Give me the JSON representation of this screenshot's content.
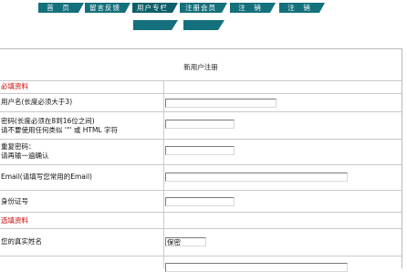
{
  "nav": {
    "tabs": [
      "首　页",
      "留言反馈",
      "用户专栏",
      "注册会员",
      "注　销",
      "注　销"
    ],
    "active_tab": "用户专栏",
    "sub_tabs": [
      "",
      ""
    ]
  },
  "form": {
    "title": "新用户注册",
    "required_section": "必填资料",
    "username_label": "用户名(长度必须大于3)",
    "password_label_1": "密码(长度必须在8到16位之间)",
    "password_label_2": "请不要使用任何类似 '\"' 或 HTML 字符",
    "confirm_label_1": "重复密码：",
    "confirm_label_2": "请再输一遍确认",
    "email_label": "Email(请填写您常用的Email)",
    "id_label": "身份证号",
    "optional_section": "选填资料",
    "realname_label": "您的真实姓名",
    "realname_value": "保密"
  },
  "colors": {
    "tab": "#14707c",
    "section_red": "#cc0000"
  }
}
